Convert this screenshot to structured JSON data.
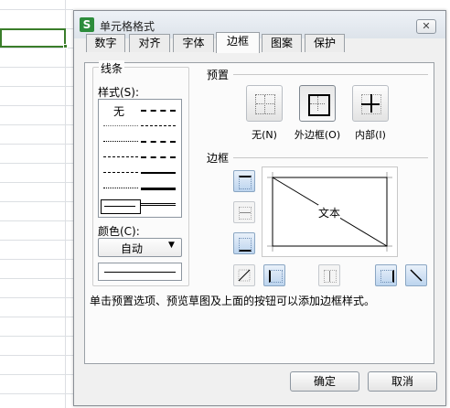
{
  "dialog": {
    "title": "单元格格式",
    "app_icon_glyph": "S",
    "close_glyph": "✕"
  },
  "tabs": [
    {
      "label": "数字"
    },
    {
      "label": "对齐"
    },
    {
      "label": "字体"
    },
    {
      "label": "边框"
    },
    {
      "label": "图案"
    },
    {
      "label": "保护"
    }
  ],
  "active_tab": "边框",
  "line_group": {
    "title": "线条",
    "style_label": "样式(S):",
    "none_label": "无",
    "color_label": "颜色(C):",
    "color_value": "自动"
  },
  "presets": {
    "title": "预置",
    "items": [
      {
        "label": "无(N)",
        "icon": "no-border-icon"
      },
      {
        "label": "外边框(O)",
        "icon": "outline-border-icon"
      },
      {
        "label": "内部(I)",
        "icon": "inside-border-icon"
      }
    ]
  },
  "border": {
    "title": "边框",
    "preview_text": "文本"
  },
  "info_text": "单击预置选项、预览草图及上面的按钮可以添加边框样式。",
  "buttons": {
    "ok": "确定",
    "cancel": "取消"
  },
  "colors": {
    "selected_cell": "#3a7d2a",
    "app_icon": "#2d8c3c",
    "toggle_on": "#bcd4ee"
  }
}
